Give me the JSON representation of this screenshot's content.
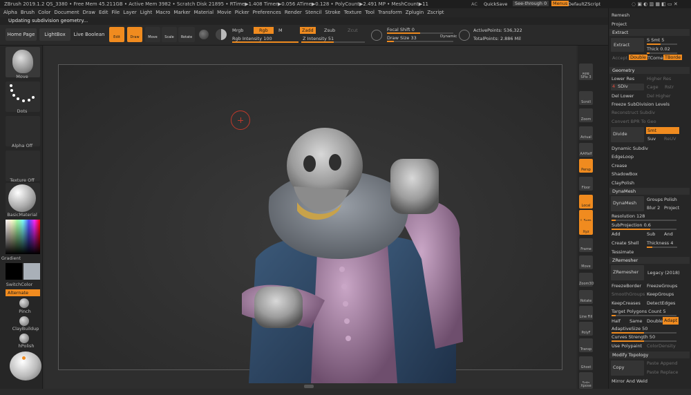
{
  "titlebar": {
    "text": "ZBrush 2019.1.2   QS_3380   • Free Mem 45.211GB • Active Mem 3982 • Scratch Disk 21895 • RTime▶1.408 Timer▶0.056 ATime▶0.128 • PolyCount▶2.491 MP • MeshCount▶11",
    "ac": "AC",
    "quicksave": "QuickSave",
    "seethrough": "See-through 0",
    "menus": "Menus",
    "script": "DefaultZScript"
  },
  "menubar": [
    "Alpha",
    "Brush",
    "Color",
    "Document",
    "Draw",
    "Edit",
    "File",
    "Layer",
    "Light",
    "Macro",
    "Marker",
    "Material",
    "Movie",
    "Picker",
    "Preferences",
    "Render",
    "Stencil",
    "Stroke",
    "Texture",
    "Tool",
    "Transform",
    "Zplugin",
    "Zscript"
  ],
  "status": "Updating subdivision geometry...",
  "shelf": {
    "home": "Home Page",
    "lightbox": "LightBox",
    "liveboolean": "Live Boolean",
    "edit": "Edit",
    "draw": "Draw",
    "move": "Move",
    "scale": "Scale",
    "rotate": "Rotate",
    "mrgb": "Mrgb",
    "rgb": "Rgb",
    "m": "M",
    "zadd": "Zadd",
    "zsub": "Zsub",
    "zcut": "Zcut",
    "rgb_intensity": "Rgb Intensity 100",
    "z_intensity": "Z Intensity 51",
    "focal_shift": "Focal Shift 0",
    "draw_size": "Draw Size 33",
    "dynamic": "Dynamic",
    "active_points": "ActivePoints: 536,322",
    "total_points": "TotalPoints: 2.886 Mil"
  },
  "lefttray": {
    "move": "Move",
    "dots": "Dots",
    "alpha": "Alpha Off",
    "texture": "Texture Off",
    "material": "BasicMaterial",
    "gradient": "Gradient",
    "switchcolor": "SwitchColor",
    "alternate": "Alternate",
    "pinch": "Pinch",
    "claybuildup": "ClayBuildup",
    "hpolish": "hPolish"
  },
  "righttray": [
    "BPR",
    "SPix 3",
    "Scroll",
    "Zoom",
    "Actual",
    "AAHalf",
    "Persp",
    "Floor",
    "Local",
    "L.Sym",
    "Xyz",
    "Frame",
    "Move",
    "Zoom3D",
    "Rotate",
    "Line Fill",
    "PolyF",
    "Transp",
    "Ghost",
    "Solo",
    "Xpose"
  ],
  "panel": {
    "remesh": "Remesh",
    "project": "Project",
    "extract_h": "Extract",
    "extract": "Extract",
    "s_smt": "S Smt 5",
    "thick": "Thick 0.02",
    "accept": "Accept",
    "double": "Double",
    "tcorne": "TCorne",
    "tborde": "TBorde",
    "geometry": "Geometry",
    "lower_res": "Lower Res",
    "higher_res": "Higher Res",
    "sdiv": "SDiv",
    "sdiv_val": "4",
    "cage": "Cage",
    "rstr": "Rstr",
    "del_lower": "Del Lower",
    "del_higher": "Del Higher",
    "freeze_sub": "Freeze SubDivision Levels",
    "reconstruct": "Reconstruct Subdiv",
    "convert_bpr": "Convert BPR To Geo",
    "divide": "Divide",
    "smt": "Smt",
    "suv": "Suv",
    "reuv": "ReUV",
    "dynamic_subdiv": "Dynamic Subdiv",
    "edgeloop": "EdgeLoop",
    "crease": "Crease",
    "shadowbox": "ShadowBox",
    "claypolish": "ClayPolish",
    "dynamesh_h": "DynaMesh",
    "dynamesh": "DynaMesh",
    "groups": "Groups",
    "polish": "Polish",
    "blur": "Blur 2",
    "project2": "Project",
    "resolution": "Resolution 128",
    "subprojection": "SubProjection 0.6",
    "add": "Add",
    "sub": "Sub",
    "and": "And",
    "create_shell": "Create Shell",
    "thickness": "Thickness 4",
    "tessimate": "Tessimate",
    "zremesher_h": "ZRemesher",
    "zremesher": "ZRemesher",
    "legacy": "Legacy (2018)",
    "freezeborder": "FreezeBorder",
    "freezegroups": "FreezeGroups",
    "smoothgroups": "SmoothGroups",
    "keepgroups": "KeepGroups",
    "keepcreases": "KeepCreases",
    "detectedges": "DetectEdges",
    "target_poly": "Target Polygons Count 5",
    "half": "Half",
    "same": "Same",
    "double2": "Double",
    "adapt": "Adapt",
    "adaptivesize": "AdaptiveSize 50",
    "curves_strength": "Curves Strength 50",
    "use_polypaint": "Use Polypaint",
    "colordensity": "ColorDensity",
    "modify_topology": "Modify Topology",
    "copy": "Copy",
    "paste_append": "Paste Append",
    "paste_replace": "Paste Replace",
    "mirror_weld": "Mirror And Weld"
  },
  "colors": {
    "accent": "#f08b1f"
  }
}
